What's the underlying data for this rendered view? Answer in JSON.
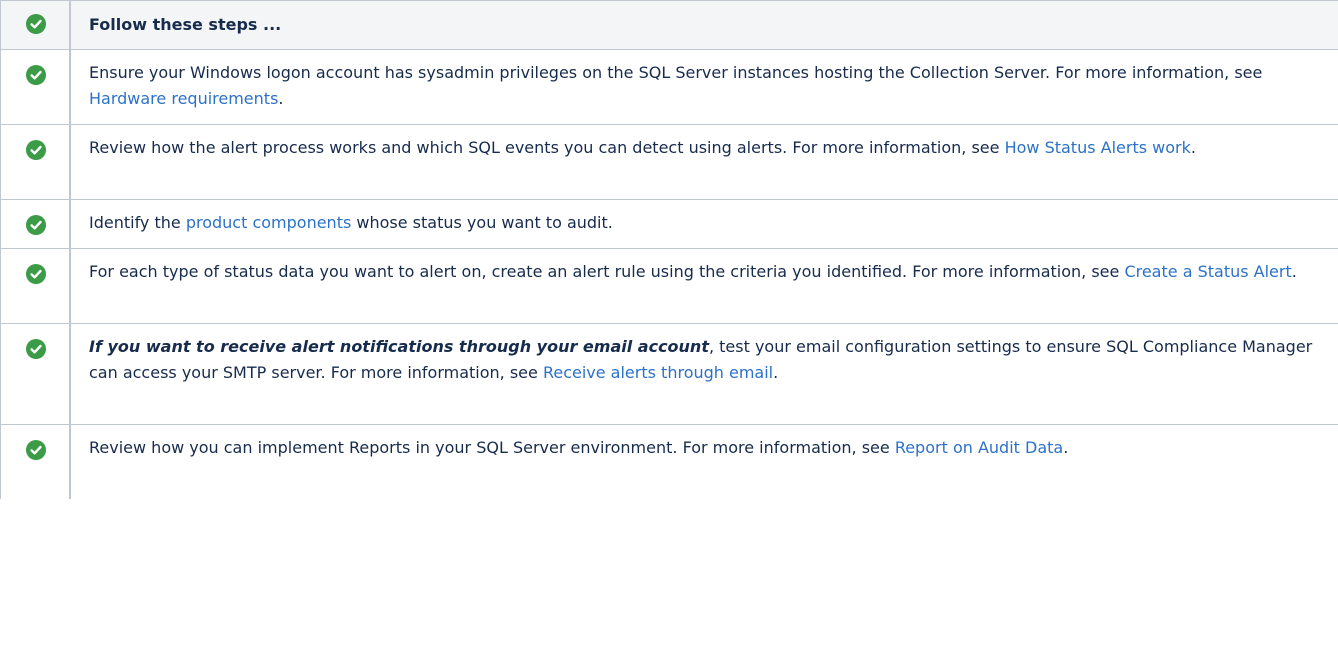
{
  "header": {
    "title": "Follow these steps ..."
  },
  "colors": {
    "check_green": "#3b9b47",
    "link": "#2c72c7",
    "border": "#c1c7d0",
    "header_bg": "#f4f5f7"
  },
  "icon": "check-circle-icon",
  "steps": [
    {
      "before": "Ensure your Windows logon account has sysadmin privileges on the SQL Server instances hosting the Collection Server. For more information, see ",
      "link": "Hardware requirements",
      "after": "."
    },
    {
      "before": "Review how the alert process works and which SQL events you can detect using alerts. For more information, see ",
      "link": "How Status Alerts work",
      "after": "."
    },
    {
      "before": "Identify the ",
      "link": "product components",
      "after": " whose status you want to audit."
    },
    {
      "before": "For each type of status data you want to alert on, create an alert rule using the criteria you identified. For more information, see ",
      "link": "Create a Status Alert",
      "after": "."
    },
    {
      "emphasis": "If you want to receive alert notifications through your email account",
      "before": ", test your email configuration settings to ensure SQL Compliance Manager can access your SMTP server. For more information, see ",
      "link": "Receive alerts through email",
      "after": "."
    },
    {
      "before": "Review how you can implement Reports in your SQL Server environment. For more information, see ",
      "link": "Report on Audit Data",
      "after": "."
    }
  ]
}
